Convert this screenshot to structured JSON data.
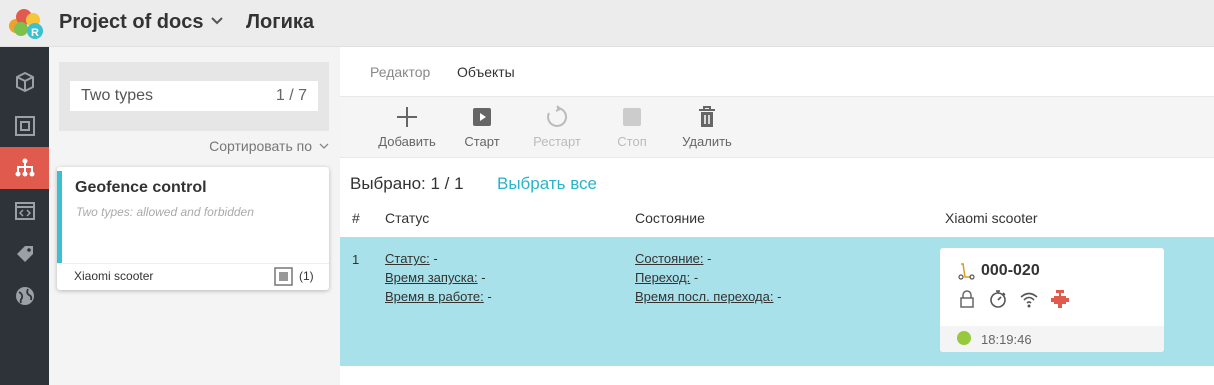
{
  "header": {
    "project_title": "Project of docs",
    "section_title": "Логика"
  },
  "sidebar": {
    "items": [
      {
        "icon": "cube-icon",
        "active": false
      },
      {
        "icon": "object-square-icon",
        "active": false
      },
      {
        "icon": "logic-tree-icon",
        "active": true
      },
      {
        "icon": "code-window-icon",
        "active": false
      },
      {
        "icon": "tag-icon",
        "active": false
      },
      {
        "icon": "globe-icon",
        "active": false
      }
    ]
  },
  "left_panel": {
    "search": {
      "value": "Two types",
      "count": "1 / 7"
    },
    "sort_label": "Сортировать по",
    "card": {
      "title": "Geofence control",
      "description": "Two types: allowed and forbidden",
      "device": "Xiaomi scooter",
      "count": "(1)"
    }
  },
  "tabs": [
    {
      "label": "Редактор",
      "active": false
    },
    {
      "label": "Объекты",
      "active": true
    }
  ],
  "toolbar": {
    "add": "Добавить",
    "start": "Старт",
    "restart": "Рестарт",
    "stop": "Стоп",
    "delete": "Удалить"
  },
  "selection": {
    "selected": "Выбрано: 1 / 1",
    "select_all": "Выбрать все"
  },
  "table": {
    "headers": [
      "#",
      "Статус",
      "Состояние",
      "Xiaomi scooter"
    ],
    "row": {
      "num": "1",
      "status": {
        "status_k": "Статус:",
        "status_v": " -",
        "launch_k": "Время запуска:",
        "launch_v": " -",
        "uptime_k": "Время в работе:",
        "uptime_v": " -"
      },
      "state": {
        "state_k": "Состояние:",
        "state_v": " -",
        "transition_k": "Переход:",
        "transition_v": " -",
        "last_k": "Время посл. перехода:",
        "last_v": " -"
      },
      "device": {
        "id": "000-020",
        "time": "18:19:46"
      }
    }
  },
  "colors": {
    "accent": "#2ab4c7",
    "sidebar_active": "#e05a4e",
    "row_selected": "#a8e1ea",
    "online_dot": "#97c93d"
  }
}
